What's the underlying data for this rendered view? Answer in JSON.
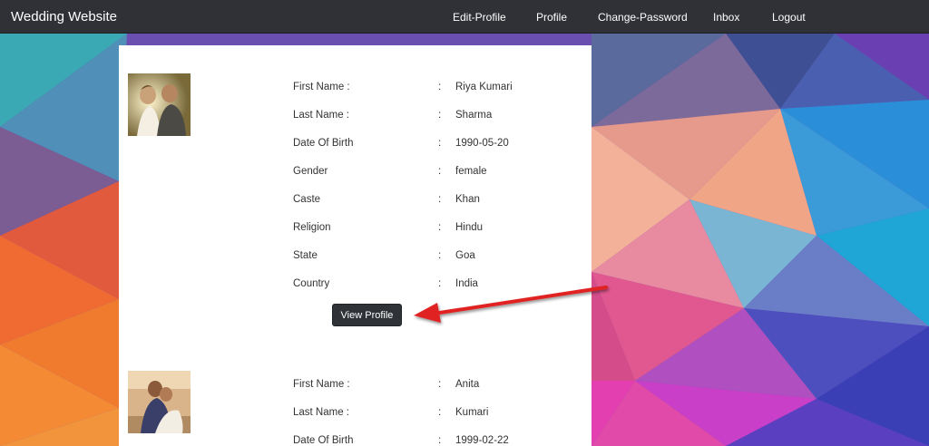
{
  "nav": {
    "brand": "Wedding Website",
    "links": [
      "Edit-Profile",
      "Profile",
      "Change-Password",
      "Inbox",
      "Logout"
    ]
  },
  "profiles": [
    {
      "fields": [
        {
          "label": "First Name :",
          "value": "Riya Kumari"
        },
        {
          "label": "Last Name :",
          "value": "Sharma"
        },
        {
          "label": "Date Of Birth",
          "value": "1990-05-20"
        },
        {
          "label": "Gender",
          "value": "female"
        },
        {
          "label": "Caste",
          "value": "Khan"
        },
        {
          "label": "Religion",
          "value": "Hindu"
        },
        {
          "label": "State",
          "value": "Goa"
        },
        {
          "label": "Country",
          "value": "India"
        }
      ],
      "button": "View Profile"
    },
    {
      "fields": [
        {
          "label": "First Name :",
          "value": "Anita"
        },
        {
          "label": "Last Name :",
          "value": "Kumari"
        },
        {
          "label": "Date Of Birth",
          "value": "1999-02-22"
        }
      ]
    }
  ],
  "colon": ":",
  "colors": {
    "navbar": "#2f3136",
    "button": "#2f3338",
    "annotation_arrow": "#e02020"
  }
}
